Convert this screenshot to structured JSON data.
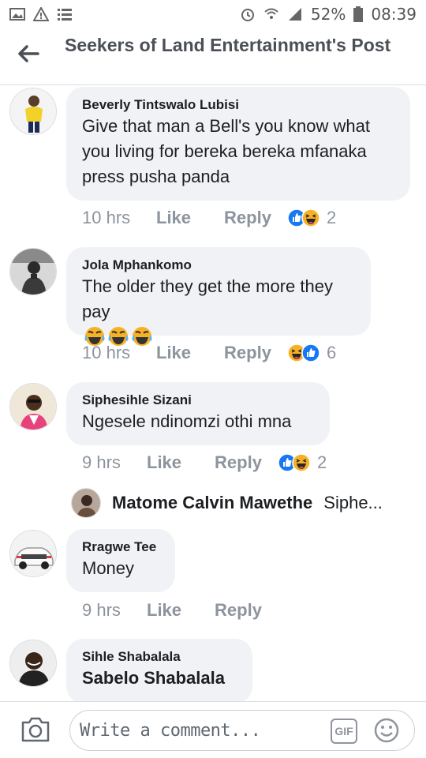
{
  "status_bar": {
    "battery": "52%",
    "time": "08:39"
  },
  "header": {
    "title": "Seekers of Land Entertainment's Post"
  },
  "comments": [
    {
      "name": "Beverly Tintswalo Lubisi",
      "text": "Give that man a Bell's you know what you living for bereka bereka mfanaka press pusha panda",
      "time": "10 hrs",
      "like": "Like",
      "reply": "Reply",
      "reaction_count": "2",
      "reactions": [
        "like-icon",
        "laugh-icon"
      ]
    },
    {
      "name": "Jola Mphankomo",
      "text": "The older they get the more they pay",
      "emojis": [
        "tears-of-joy-icon",
        "tears-of-joy-icon",
        "tears-of-joy-icon"
      ],
      "time": "10 hrs",
      "like": "Like",
      "reply": "Reply",
      "reaction_count": "6",
      "reactions": [
        "laugh-icon",
        "like-icon"
      ]
    },
    {
      "name": "Siphesihle Sizani",
      "text": "Ngesele ndinomzi othi mna",
      "time": "9 hrs",
      "like": "Like",
      "reply": "Reply",
      "reaction_count": "2",
      "reactions": [
        "like-icon",
        "laugh-icon"
      ]
    },
    {
      "name": "Rragwe Tee",
      "text": "Money",
      "time": "9 hrs",
      "like": "Like",
      "reply": "Reply"
    },
    {
      "name": "Sihle Shabalala",
      "text": "Sabelo Shabalala"
    }
  ],
  "reply_preview": {
    "name": "Matome Calvin Mawethe",
    "text": "Siphe..."
  },
  "composer": {
    "placeholder": "Write a comment...",
    "gif_label": "GIF"
  },
  "colors": {
    "like_blue": "#1877f2",
    "laugh_yellow": "#f7b125",
    "bubble_bg": "#f0f2f5"
  }
}
